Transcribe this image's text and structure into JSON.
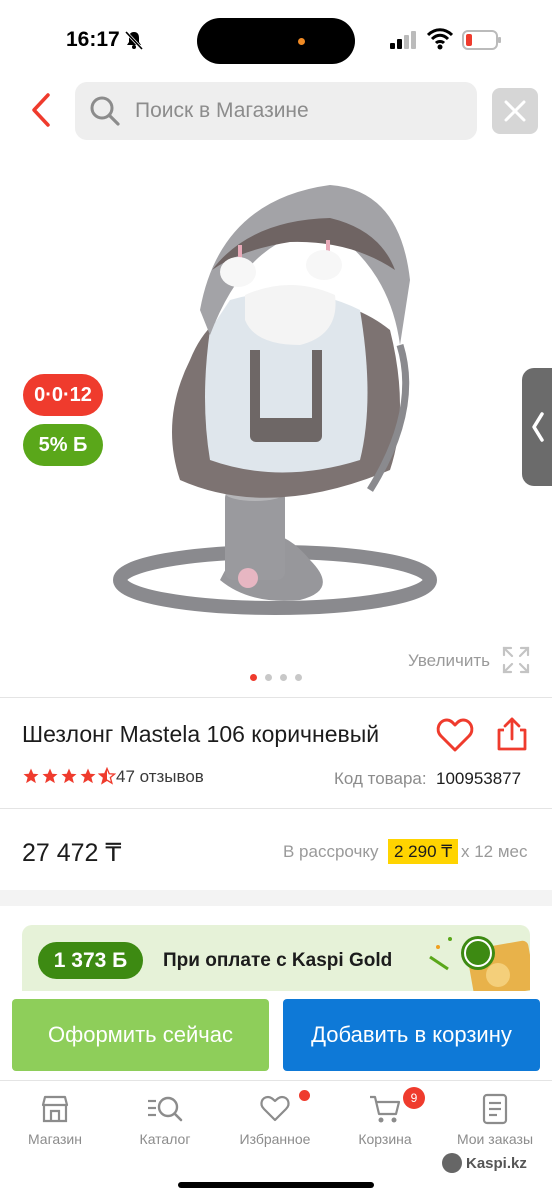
{
  "status_bar": {
    "time": "16:17"
  },
  "search": {
    "placeholder": "Поиск в Магазине"
  },
  "badges": {
    "installment": "0·0·12",
    "bonus": "5% Б"
  },
  "gallery": {
    "zoom_label": "Увеличить",
    "total_images": 4,
    "active_index": 0
  },
  "product": {
    "title": "Шезлонг Mastela 106 коричневый",
    "rating": 4.5,
    "reviews": "47 отзывов",
    "code_label": "Код товара:",
    "code_value": "100953877"
  },
  "price": {
    "value": "27 472 ₸",
    "rassrochka_label": "В рассрочку",
    "rassrochka_amount": "2 290 ₸",
    "rassrochka_term": "x 12 мес"
  },
  "promo": {
    "bonus": "1 373 Б",
    "text": "При оплате с Kaspi Gold"
  },
  "actions": {
    "buy_now": "Оформить сейчас",
    "add_to_cart": "Добавить в корзину"
  },
  "bottom_nav": {
    "items": [
      {
        "label": "Магазин",
        "icon": "store-icon"
      },
      {
        "label": "Каталог",
        "icon": "catalog-icon"
      },
      {
        "label": "Избранное",
        "icon": "heart-icon"
      },
      {
        "label": "Корзина",
        "icon": "cart-icon"
      },
      {
        "label": "Мои заказы",
        "icon": "orders-icon"
      }
    ],
    "cart_count": "9"
  },
  "watermark": "Kaspi.kz",
  "colors": {
    "accent_red": "#ef3b2d",
    "accent_green": "#5aa71a",
    "accent_blue": "#0e79d7",
    "highlight_yellow": "#ffd400"
  }
}
